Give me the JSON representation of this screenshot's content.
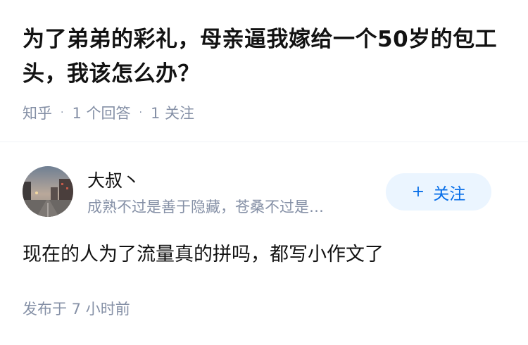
{
  "question": {
    "title": "为了弟弟的彩礼，母亲逼我嫁给一个50岁的包工头，我该怎么办？",
    "source": "知乎",
    "answers": "1 个回答",
    "followers": "1 关注",
    "separator": "·"
  },
  "answer": {
    "author_name": "大叔丶",
    "author_bio": "成熟不过是善于隐藏，苍桑不过是…",
    "follow_plus": "+",
    "follow_label": "关注",
    "content": "现在的人为了流量真的拼吗，都写小作文了",
    "publish_time": "发布于 7 小时前"
  },
  "colors": {
    "accent": "#056de8",
    "follow_bg": "#ebf5ff",
    "meta": "#8590a6"
  }
}
